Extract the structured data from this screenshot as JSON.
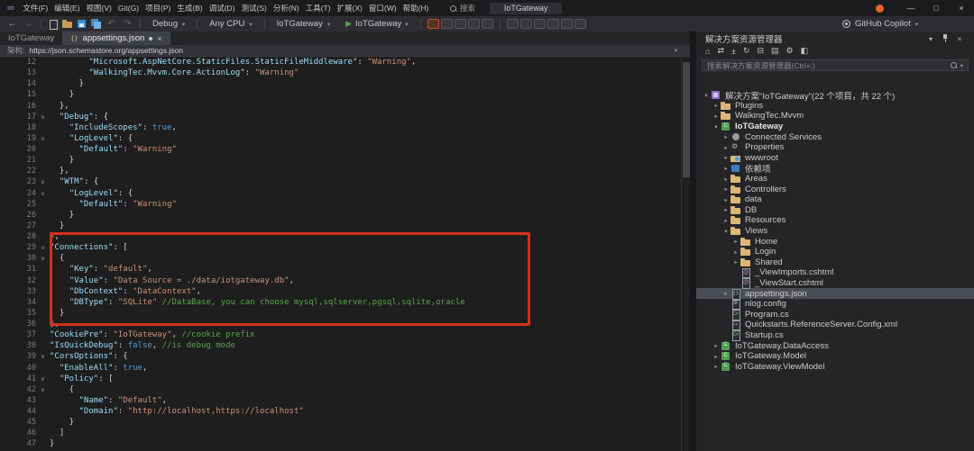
{
  "titlebar": {
    "menus": [
      "文件(F)",
      "编辑(E)",
      "视图(V)",
      "Git(G)",
      "项目(P)",
      "生成(B)",
      "调试(D)",
      "测试(S)",
      "分析(N)",
      "工具(T)",
      "扩展(X)",
      "窗口(W)",
      "帮助(H)"
    ],
    "search_placeholder": "搜索",
    "title": "IoTGateway"
  },
  "toolbar": {
    "config_dropdown": "Debug",
    "platform_dropdown": "Any CPU",
    "project_dropdown": "IoTGateway",
    "run_button": "IoTGateway",
    "copilot_label": "GitHub Copilot",
    "debug_icon_names": [
      "hot-reload-icon",
      "stop-debug-icon",
      "restart-icon",
      "step-into-icon",
      "step-over-icon"
    ],
    "misc_icon_names": [
      "find-in-files-icon",
      "navigate-backward-icon",
      "comment-icon",
      "uncomment-icon",
      "bookmark-icon",
      "outline-icon"
    ]
  },
  "tabs": [
    {
      "label": "IoTGateway",
      "active": false
    },
    {
      "label": "appsettings.json",
      "active": true
    }
  ],
  "schema_bar": {
    "label": "架构:",
    "value": "https://json.schemastore.org/appsettings.json"
  },
  "editor": {
    "lines": [
      {
        "n": 12,
        "f": false,
        "t": [
          [
            "p",
            "        "
          ],
          [
            "k",
            "\"Microsoft.AspNetCore.StaticFiles.StaticFileMiddleware\""
          ],
          [
            "p",
            ": "
          ],
          [
            "s",
            "\"Warning\""
          ],
          [
            "p",
            ","
          ]
        ]
      },
      {
        "n": 13,
        "f": false,
        "t": [
          [
            "p",
            "        "
          ],
          [
            "k",
            "\"WalkingTec.Mvvm.Core.ActionLog\""
          ],
          [
            "p",
            ": "
          ],
          [
            "s",
            "\"Warning\""
          ]
        ]
      },
      {
        "n": 14,
        "f": false,
        "t": [
          [
            "p",
            "      }"
          ]
        ]
      },
      {
        "n": 15,
        "f": false,
        "t": [
          [
            "p",
            "    }"
          ]
        ]
      },
      {
        "n": 16,
        "f": false,
        "t": [
          [
            "p",
            "  },"
          ]
        ]
      },
      {
        "n": 17,
        "f": true,
        "t": [
          [
            "p",
            "  "
          ],
          [
            "k",
            "\"Debug\""
          ],
          [
            "p",
            ": {"
          ]
        ]
      },
      {
        "n": 18,
        "f": false,
        "t": [
          [
            "p",
            "    "
          ],
          [
            "k",
            "\"IncludeScopes\""
          ],
          [
            "p",
            ": "
          ],
          [
            "b",
            "true"
          ],
          [
            "p",
            ","
          ]
        ]
      },
      {
        "n": 19,
        "f": true,
        "t": [
          [
            "p",
            "    "
          ],
          [
            "k",
            "\"LogLevel\""
          ],
          [
            "p",
            ": {"
          ]
        ]
      },
      {
        "n": 20,
        "f": false,
        "t": [
          [
            "p",
            "      "
          ],
          [
            "k",
            "\"Default\""
          ],
          [
            "p",
            ": "
          ],
          [
            "s",
            "\"Warning\""
          ]
        ]
      },
      {
        "n": 21,
        "f": false,
        "t": [
          [
            "p",
            "    }"
          ]
        ]
      },
      {
        "n": 22,
        "f": false,
        "t": [
          [
            "p",
            "  },"
          ]
        ]
      },
      {
        "n": 23,
        "f": true,
        "t": [
          [
            "p",
            "  "
          ],
          [
            "k",
            "\"WTM\""
          ],
          [
            "p",
            ": {"
          ]
        ]
      },
      {
        "n": 24,
        "f": true,
        "t": [
          [
            "p",
            "    "
          ],
          [
            "k",
            "\"LogLevel\""
          ],
          [
            "p",
            ": {"
          ]
        ]
      },
      {
        "n": 25,
        "f": false,
        "t": [
          [
            "p",
            "      "
          ],
          [
            "k",
            "\"Default\""
          ],
          [
            "p",
            ": "
          ],
          [
            "s",
            "\"Warning\""
          ]
        ]
      },
      {
        "n": 26,
        "f": false,
        "t": [
          [
            "p",
            "    }"
          ]
        ]
      },
      {
        "n": 27,
        "f": false,
        "t": [
          [
            "p",
            "  }"
          ]
        ]
      },
      {
        "n": 28,
        "f": false,
        "t": [
          [
            "p",
            "},"
          ]
        ]
      },
      {
        "n": 29,
        "f": true,
        "t": [
          [
            "k",
            "\"Connections\""
          ],
          [
            "p",
            ": ["
          ]
        ]
      },
      {
        "n": 30,
        "f": true,
        "t": [
          [
            "p",
            "  {"
          ]
        ]
      },
      {
        "n": 31,
        "f": false,
        "t": [
          [
            "p",
            "    "
          ],
          [
            "k",
            "\"Key\""
          ],
          [
            "p",
            ": "
          ],
          [
            "s",
            "\"default\""
          ],
          [
            "p",
            ","
          ]
        ]
      },
      {
        "n": 32,
        "f": false,
        "t": [
          [
            "p",
            "    "
          ],
          [
            "k",
            "\"Value\""
          ],
          [
            "p",
            ": "
          ],
          [
            "s",
            "\"Data Source = ./data/iotgateway.db\""
          ],
          [
            "p",
            ","
          ]
        ]
      },
      {
        "n": 33,
        "f": false,
        "t": [
          [
            "p",
            "    "
          ],
          [
            "k",
            "\"DbContext\""
          ],
          [
            "p",
            ": "
          ],
          [
            "s",
            "\"DataContext\""
          ],
          [
            "p",
            ","
          ]
        ]
      },
      {
        "n": 34,
        "f": false,
        "t": [
          [
            "p",
            "    "
          ],
          [
            "k",
            "\"DBType\""
          ],
          [
            "p",
            ": "
          ],
          [
            "s",
            "\"SQLite\""
          ],
          [
            "p",
            " "
          ],
          [
            "c",
            "//DataBase, you can choose mysql,sqlserver,pgsql,sqlite,oracle"
          ]
        ]
      },
      {
        "n": 35,
        "f": false,
        "t": [
          [
            "p",
            "  }"
          ]
        ]
      },
      {
        "n": 36,
        "f": false,
        "t": [
          [
            "p",
            "],"
          ]
        ]
      },
      {
        "n": 37,
        "f": false,
        "t": [
          [
            "k",
            "\"CookiePre\""
          ],
          [
            "p",
            ": "
          ],
          [
            "s",
            "\"IoTGateway\""
          ],
          [
            "p",
            ", "
          ],
          [
            "c",
            "//cookie prefix"
          ]
        ]
      },
      {
        "n": 38,
        "f": false,
        "t": [
          [
            "k",
            "\"IsQuickDebug\""
          ],
          [
            "p",
            ": "
          ],
          [
            "b",
            "false"
          ],
          [
            "p",
            ", "
          ],
          [
            "c",
            "//is debug mode"
          ]
        ]
      },
      {
        "n": 39,
        "f": true,
        "t": [
          [
            "k",
            "\"CorsOptions\""
          ],
          [
            "p",
            ": {"
          ]
        ]
      },
      {
        "n": 40,
        "f": false,
        "t": [
          [
            "p",
            "  "
          ],
          [
            "k",
            "\"EnableAll\""
          ],
          [
            "p",
            ": "
          ],
          [
            "b",
            "true"
          ],
          [
            "p",
            ","
          ]
        ]
      },
      {
        "n": 41,
        "f": true,
        "t": [
          [
            "p",
            "  "
          ],
          [
            "k",
            "\"Policy\""
          ],
          [
            "p",
            ": ["
          ]
        ]
      },
      {
        "n": 42,
        "f": true,
        "t": [
          [
            "p",
            "    {"
          ]
        ]
      },
      {
        "n": 43,
        "f": false,
        "t": [
          [
            "p",
            "      "
          ],
          [
            "k",
            "\"Name\""
          ],
          [
            "p",
            ": "
          ],
          [
            "s",
            "\"Default\""
          ],
          [
            "p",
            ","
          ]
        ]
      },
      {
        "n": 44,
        "f": false,
        "t": [
          [
            "p",
            "      "
          ],
          [
            "k",
            "\"Domain\""
          ],
          [
            "p",
            ": "
          ],
          [
            "s",
            "\"http://localhost,https://localhost\""
          ]
        ]
      },
      {
        "n": 45,
        "f": false,
        "t": [
          [
            "p",
            "    }"
          ]
        ]
      },
      {
        "n": 46,
        "f": false,
        "t": [
          [
            "p",
            "  ]"
          ]
        ]
      },
      {
        "n": 47,
        "f": false,
        "t": [
          [
            "p",
            "}"
          ]
        ]
      }
    ]
  },
  "annotation": {
    "color": "#d5301d",
    "purpose": "highlights Connections section lines 29-36"
  },
  "explorer": {
    "title": "解决方案资源管理器",
    "search_placeholder": "搜索解决方案资源管理器(Ctrl+;)",
    "toolbar_icons": [
      {
        "name": "home-icon",
        "g": "⌂"
      },
      {
        "name": "switch-views-icon",
        "g": "⇄"
      },
      {
        "name": "pending-changes-filter-icon",
        "g": "±"
      },
      {
        "name": "refresh-icon",
        "g": "↻"
      },
      {
        "name": "collapse-all-icon",
        "g": "⊟"
      },
      {
        "name": "show-all-files-icon",
        "g": "▤"
      },
      {
        "name": "properties-icon",
        "g": "⚙"
      },
      {
        "name": "preview-selected-icon",
        "g": "◧"
      }
    ],
    "tree": [
      {
        "id": "solution",
        "d": 0,
        "c": "exp",
        "icon": "solution",
        "label": "解决方案\"IoTGateway\"(22 个项目，共 22 个)"
      },
      {
        "id": "plugins",
        "d": 1,
        "c": "col",
        "icon": "folder",
        "label": "Plugins"
      },
      {
        "id": "walkingtec-mvvm",
        "d": 1,
        "c": "col",
        "icon": "folder",
        "label": "WalkingTec.Mvvm"
      },
      {
        "id": "iotgateway",
        "d": 1,
        "c": "exp",
        "icon": "project",
        "label": "IoTGateway",
        "b": true
      },
      {
        "id": "connected-services",
        "d": 2,
        "c": "col",
        "icon": "service",
        "label": "Connected Services"
      },
      {
        "id": "properties",
        "d": 2,
        "c": "col",
        "icon": "props",
        "label": "Properties"
      },
      {
        "id": "wwwroot",
        "d": 2,
        "c": "col",
        "icon": "www",
        "label": "wwwroot"
      },
      {
        "id": "dependencies",
        "d": 2,
        "c": "col",
        "icon": "deps",
        "label": "依赖项"
      },
      {
        "id": "areas",
        "d": 2,
        "c": "col",
        "icon": "folder",
        "label": "Areas"
      },
      {
        "id": "controllers",
        "d": 2,
        "c": "col",
        "icon": "folder",
        "label": "Controllers"
      },
      {
        "id": "data",
        "d": 2,
        "c": "col",
        "icon": "folder",
        "label": "data"
      },
      {
        "id": "db",
        "d": 2,
        "c": "col",
        "icon": "folder",
        "label": "DB"
      },
      {
        "id": "resources",
        "d": 2,
        "c": "col",
        "icon": "folder",
        "label": "Resources"
      },
      {
        "id": "views",
        "d": 2,
        "c": "exp",
        "icon": "folder",
        "label": "Views"
      },
      {
        "id": "home",
        "d": 3,
        "c": "col",
        "icon": "folder",
        "label": "Home"
      },
      {
        "id": "login",
        "d": 3,
        "c": "col",
        "icon": "folder",
        "label": "Login"
      },
      {
        "id": "shared",
        "d": 3,
        "c": "col",
        "icon": "folder",
        "label": "Shared"
      },
      {
        "id": "viewimports-cshtml",
        "d": 3,
        "c": "none",
        "icon": "cshtml",
        "label": "_ViewImports.cshtml"
      },
      {
        "id": "viewstart-cshtml",
        "d": 3,
        "c": "none",
        "icon": "cshtml",
        "label": "_ViewStart.cshtml"
      },
      {
        "id": "appsettings-json",
        "d": 2,
        "c": "col",
        "icon": "json",
        "label": "appsettings.json",
        "sel": true
      },
      {
        "id": "nlog-config",
        "d": 2,
        "c": "none",
        "icon": "config",
        "label": "nlog.config"
      },
      {
        "id": "program-cs",
        "d": 2,
        "c": "none",
        "icon": "cs",
        "label": "Program.cs"
      },
      {
        "id": "quickstarts-xml",
        "d": 2,
        "c": "none",
        "icon": "xml",
        "label": "Quickstarts.ReferenceServer.Config.xml"
      },
      {
        "id": "startup-cs",
        "d": 2,
        "c": "none",
        "icon": "cs",
        "label": "Startup.cs"
      },
      {
        "id": "iotgateway-dataaccess",
        "d": 1,
        "c": "col",
        "icon": "project",
        "label": "IoTGateway.DataAccess"
      },
      {
        "id": "iotgateway-model",
        "d": 1,
        "c": "col",
        "icon": "project",
        "label": "IoTGateway.Model"
      },
      {
        "id": "iotgateway-viewmodel",
        "d": 1,
        "c": "col",
        "icon": "project",
        "label": "IoTGateway.ViewModel"
      }
    ]
  },
  "icons": {
    "back": "←",
    "forward": "→",
    "undo": "↶",
    "redo": "↷",
    "play": "▶",
    "dropdown": "▾",
    "close": "×",
    "minimize": "—",
    "maximize": "□",
    "fold": "∨",
    "tree_collapsed": "▸",
    "tree_expanded": "▾",
    "json_glyph": "{}"
  },
  "colors": {
    "accent": "#007acc",
    "run_green": "#4cae50",
    "annotation_red": "#d5301d",
    "folder_tan": "#dcb67a"
  }
}
